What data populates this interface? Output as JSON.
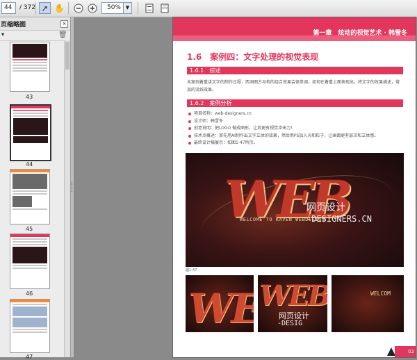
{
  "toolbar": {
    "page_current": "44",
    "page_total": "/ 372",
    "zoom": "50%"
  },
  "panel": {
    "title": "页缩略图",
    "close": "×",
    "options": "▾",
    "thumbnails": [
      {
        "num": "43"
      },
      {
        "num": "44"
      },
      {
        "num": "45"
      },
      {
        "num": "46"
      },
      {
        "num": "47"
      }
    ]
  },
  "page": {
    "chapter": "第一章　炫动的视觉艺术 · 韩雪冬",
    "section_title": "1.6　案例四：文字处理的视觉表现",
    "sub1": "1.6.1　综述",
    "para1": "本案例着重讲文字的制作过程，西洞图方与构的组合效果会很单调，如何在着重上面表现出，将文字的效果描述，增加的流线效果。",
    "sub2": "1.6.2　案例分析",
    "bullets": [
      "项目名称：web-designers.cn",
      "设计师：韩雪冬",
      "创意说明：把LOGO 做成图形，让其更有视觉冲击力！",
      "技术点概述：首先用AI制作出文字立体的效果，然后用PS加入光和粒子，让画面更有层次和立体感。",
      "最终设计稿展示：如图1-47所示。"
    ],
    "hero_big": "WEB",
    "hero_cn": "网页设计",
    "hero_en": "-DESIGNERS.CN",
    "hero_welcome": "WELCOME TO KAVEN WEBDESIGN",
    "fig_caption": "图1-47",
    "sub_img2_cn": "网页设计",
    "sub_img2_en": "-DESIG",
    "sub_img3_text": "WELCOM",
    "page_number": "02"
  }
}
